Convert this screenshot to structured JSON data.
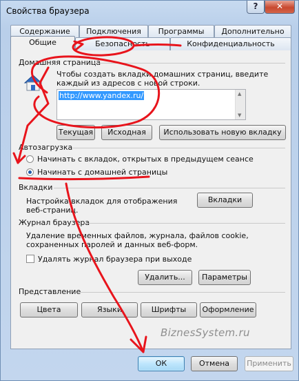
{
  "window": {
    "title": "Свойства браузера",
    "help": "?",
    "close": "✕"
  },
  "tabs": {
    "row1": [
      "Содержание",
      "Подключения",
      "Программы",
      "Дополнительно"
    ],
    "row2": [
      "Общие",
      "Безопасность",
      "Конфиденциальность"
    ],
    "active": "Общие"
  },
  "home": {
    "section": "Домашняя страница",
    "description_line1": "Чтобы создать вкладки домашних страниц, введите",
    "description_line2": "каждый из адресов с новой строки.",
    "url": "http://www.yandex.ru/",
    "buttons": {
      "current": "Текущая",
      "default": "Исходная",
      "new_tab": "Использовать новую вкладку"
    }
  },
  "startup": {
    "section": "Автозагрузка",
    "option_tabs": "Начинать с вкладок, открытых в предыдущем сеансе",
    "option_home": "Начинать с домашней страницы",
    "selected": "home"
  },
  "tabs_section": {
    "section": "Вкладки",
    "description_line1": "Настройка вкладок для отображения",
    "description_line2": "веб-страниц.",
    "button": "Вкладки"
  },
  "history": {
    "section": "Журнал браузера",
    "description_line1": "Удаление временных файлов, журнала, файлов cookie,",
    "description_line2": "сохраненных паролей и данных веб-форм.",
    "checkbox_label": "Удалять журнал браузера при выходе",
    "checkbox_checked": false,
    "delete_button": "Удалить...",
    "settings_button": "Параметры"
  },
  "appearance": {
    "section": "Представление",
    "buttons": [
      "Цвета",
      "Языки",
      "Шрифты",
      "Оформление"
    ]
  },
  "footer": {
    "ok": "ОК",
    "cancel": "Отмена",
    "apply": "Применить"
  },
  "watermark": "BiznesSystem.ru",
  "colors": {
    "annotation_red": "#e8141c",
    "selection_blue": "#3399ff"
  }
}
